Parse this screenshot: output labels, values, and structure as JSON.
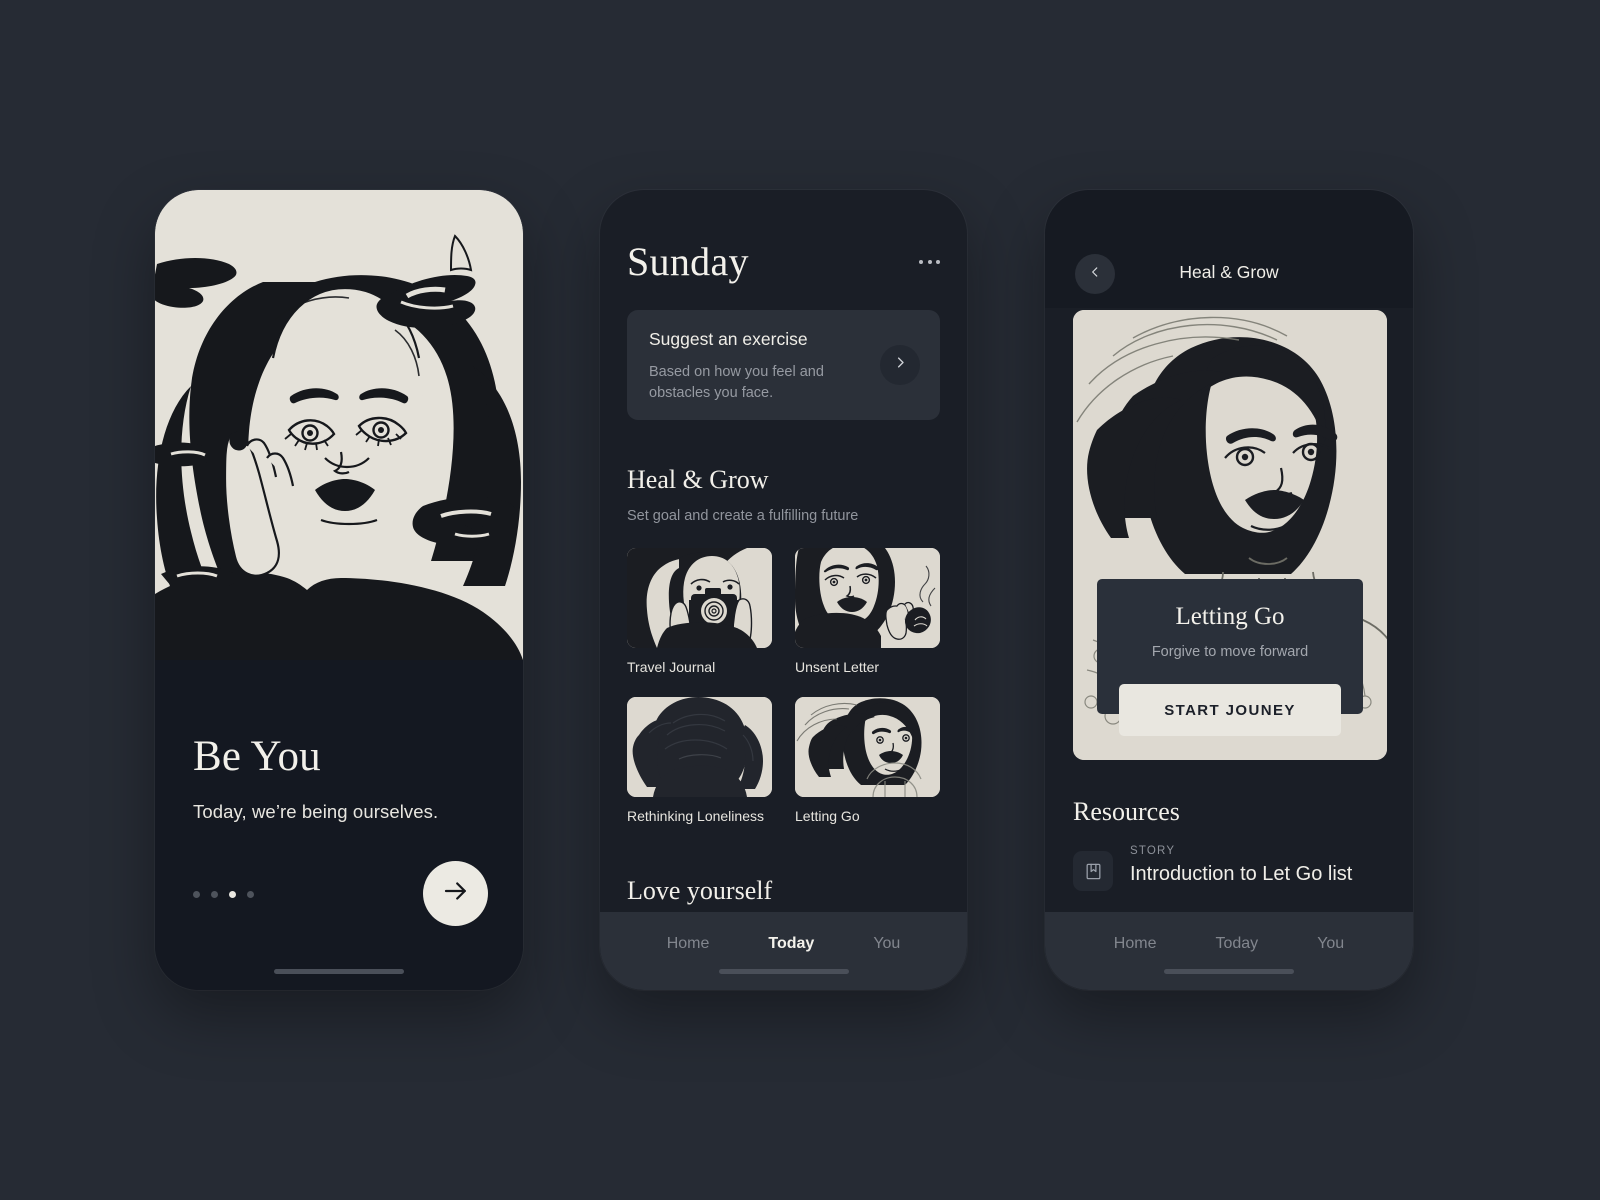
{
  "theme": {
    "page_background": "#262b34",
    "screen_background": "#1a1e26",
    "cream": "#e4e1d9",
    "card": "#2b3039",
    "text_primary": "#f2f0ea",
    "text_muted": "#91959d"
  },
  "screen_onboarding": {
    "title": "Be You",
    "subtitle": "Today, we’re being ourselves.",
    "illustration_alt": "woman-with-orcas-illustration",
    "pagination": {
      "total": 4,
      "active_index": 2
    },
    "next_icon": "arrow-right-icon"
  },
  "screen_today": {
    "header": {
      "title": "Sunday",
      "menu_icon": "more-horizontal-icon"
    },
    "suggest_card": {
      "title": "Suggest an exercise",
      "description": "Based on how you feel and obstacles you face.",
      "arrow_icon": "chevron-right-icon"
    },
    "heal_section": {
      "title": "Heal & Grow",
      "subtitle": "Set goal and create a fulfilling future",
      "tiles": [
        {
          "label": "Travel Journal",
          "image_alt": "woman-with-camera-illustration"
        },
        {
          "label": "Unsent Letter",
          "image_alt": "woman-holding-rose-illustration"
        },
        {
          "label": "Rethinking Loneliness",
          "image_alt": "woman-hair-back-illustration"
        },
        {
          "label": "Letting Go",
          "image_alt": "woman-windswept-hair-illustration"
        }
      ]
    },
    "love_section": {
      "title": "Love yourself"
    },
    "tabs": [
      {
        "label": "Home",
        "active": false
      },
      {
        "label": "Today",
        "active": true
      },
      {
        "label": "You",
        "active": false
      }
    ]
  },
  "screen_detail": {
    "back_icon": "chevron-left-icon",
    "title": "Heal & Grow",
    "hero": {
      "image_alt": "woman-windswept-hair-portrait-illustration"
    },
    "overlay": {
      "title": "Letting Go",
      "subtitle": "Forgive to move forward",
      "cta": "START JOUNEY"
    },
    "resources": {
      "title": "Resources",
      "items": [
        {
          "icon": "bookmark-book-icon",
          "kicker": "STORY",
          "name": "Introduction to Let Go list"
        }
      ]
    },
    "tabs": [
      {
        "label": "Home",
        "active": false
      },
      {
        "label": "Today",
        "active": false
      },
      {
        "label": "You",
        "active": false
      }
    ]
  }
}
